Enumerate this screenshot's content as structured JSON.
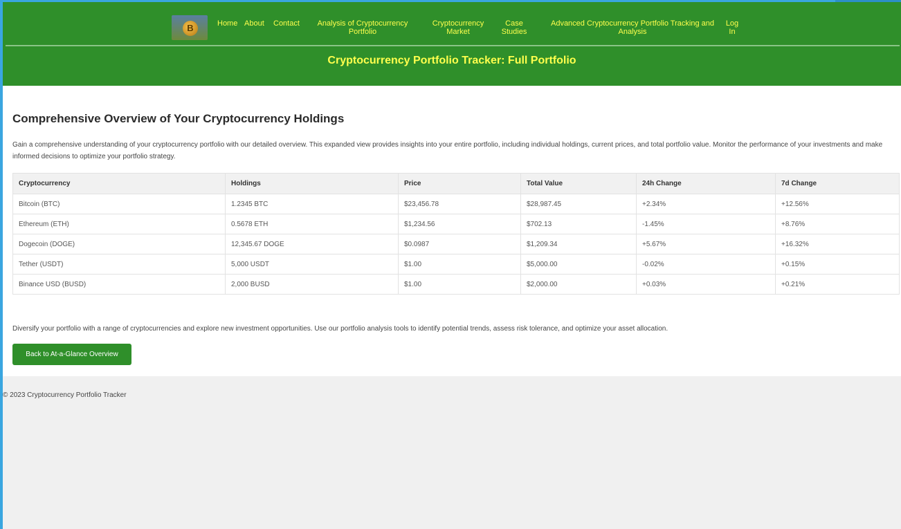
{
  "nav": {
    "logo_letter": "B",
    "items": [
      {
        "label": "Home"
      },
      {
        "label": "About"
      },
      {
        "label": "Contact"
      },
      {
        "label": "Analysis of Cryptocurrency Portfolio"
      },
      {
        "label": "Cryptocurrency Market"
      },
      {
        "label": "Case Studies"
      },
      {
        "label": "Advanced Cryptocurrency Portfolio Tracking and Analysis"
      },
      {
        "label": "Log In"
      }
    ]
  },
  "banner": {
    "title": "Cryptocurrency Portfolio Tracker: Full Portfolio"
  },
  "main": {
    "heading": "Comprehensive Overview of Your Cryptocurrency Holdings",
    "intro": "Gain a comprehensive understanding of your cryptocurrency portfolio with our detailed overview. This expanded view provides insights into your entire portfolio, including individual holdings, current prices, and total portfolio value. Monitor the performance of your investments and make informed decisions to optimize your portfolio strategy.",
    "table": {
      "headers": [
        "Cryptocurrency",
        "Holdings",
        "Price",
        "Total Value",
        "24h Change",
        "7d Change"
      ],
      "rows": [
        [
          "Bitcoin (BTC)",
          "1.2345 BTC",
          "$23,456.78",
          "$28,987.45",
          "+2.34%",
          "+12.56%"
        ],
        [
          "Ethereum (ETH)",
          "0.5678 ETH",
          "$1,234.56",
          "$702.13",
          "-1.45%",
          "+8.76%"
        ],
        [
          "Dogecoin (DOGE)",
          "12,345.67 DOGE",
          "$0.0987",
          "$1,209.34",
          "+5.67%",
          "+16.32%"
        ],
        [
          "Tether (USDT)",
          "5,000 USDT",
          "$1.00",
          "$5,000.00",
          "-0.02%",
          "+0.15%"
        ],
        [
          "Binance USD (BUSD)",
          "2,000 BUSD",
          "$1.00",
          "$2,000.00",
          "+0.03%",
          "+0.21%"
        ]
      ]
    },
    "outro": "Diversify your portfolio with a range of cryptocurrencies and explore new investment opportunities. Use our portfolio analysis tools to identify potential trends, assess risk tolerance, and optimize your asset allocation.",
    "back_button": "Back to At-a-Glance Overview"
  },
  "footer": {
    "text": "© 2023 Cryptocurrency Portfolio Tracker"
  },
  "colors": {
    "header_green": "#2f8f2a",
    "nav_yellow": "#ffff4d"
  }
}
